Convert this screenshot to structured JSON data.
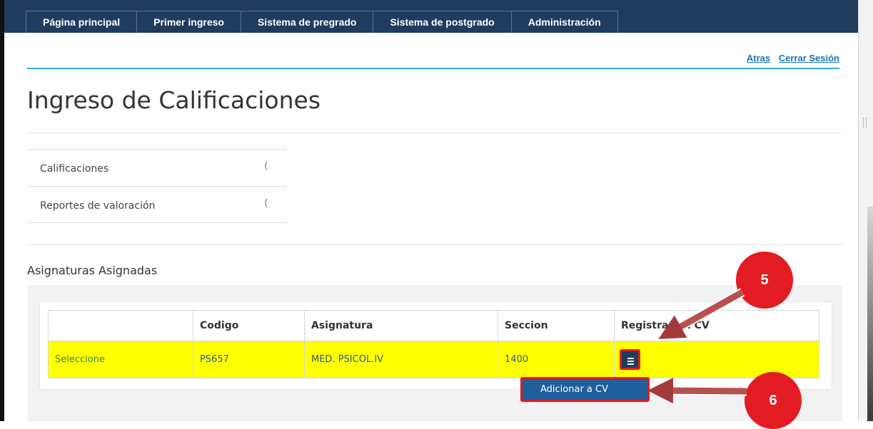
{
  "nav": {
    "tabs": [
      {
        "label": "Página principal"
      },
      {
        "label": "Primer ingreso"
      },
      {
        "label": "Sistema de pregrado"
      },
      {
        "label": "Sistema de postgrado"
      },
      {
        "label": "Administración"
      }
    ]
  },
  "header_links": {
    "back": "Atras",
    "logout": "Cerrar Sesión"
  },
  "page": {
    "title": "Ingreso de Calificaciones"
  },
  "side_menu": {
    "items": [
      {
        "label": "Calificaciones",
        "icon": "chevron-left-icon"
      },
      {
        "label": "Reportes de valoración",
        "icon": "chevron-left-icon"
      }
    ]
  },
  "section": {
    "title": "Asignaturas Asignadas"
  },
  "table": {
    "headers": [
      "",
      "Codigo",
      "Asignatura",
      "Seccion",
      "Registrar en CV"
    ],
    "rows": [
      {
        "select_link": "Seleccione",
        "codigo": "PS657",
        "asignatura": "MED. PSICOL.IV",
        "seccion": "1400",
        "action_icon": "hamburger-menu-icon"
      }
    ]
  },
  "dropdown": {
    "item": "Adicionar a CV"
  },
  "annotations": {
    "step5": "5",
    "step6": "6",
    "color": "#e31b23"
  },
  "colors": {
    "nav_bg": "#1f3c5e",
    "accent_line": "#2ab0df",
    "row_highlight": "#ffff00",
    "link": "#1a73b8"
  }
}
